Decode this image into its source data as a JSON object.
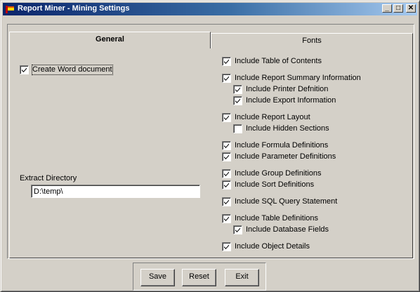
{
  "window": {
    "title": "Report Miner - Mining Settings",
    "controls": {
      "minimize": "_",
      "maximize": "□",
      "close": "✕"
    }
  },
  "tabs": [
    {
      "label": "General",
      "selected": true
    },
    {
      "label": "Fonts",
      "selected": false
    }
  ],
  "general": {
    "create_word": {
      "label": "Create Word document",
      "checked": true
    },
    "extract_directory": {
      "label": "Extract Directory",
      "value": "D:\\temp\\"
    }
  },
  "options": [
    {
      "label": "Include Table of Contents",
      "checked": true
    },
    {
      "label": "Include Report Summary Information",
      "checked": true
    },
    {
      "label": "Include Printer Defnition",
      "checked": true
    },
    {
      "label": "Include Export Information",
      "checked": true
    },
    {
      "label": "Include Report Layout",
      "checked": true
    },
    {
      "label": "Include Hidden Sections",
      "checked": false
    },
    {
      "label": "Include Formula Definitions",
      "checked": true
    },
    {
      "label": "Include Parameter Definitions",
      "checked": true
    },
    {
      "label": "Include Group Definitions",
      "checked": true
    },
    {
      "label": "Include Sort Definitions",
      "checked": true
    },
    {
      "label": "Include SQL Query Statement",
      "checked": true
    },
    {
      "label": "Include Table Definitions",
      "checked": true
    },
    {
      "label": "Include Database Fields",
      "checked": true
    },
    {
      "label": "Include Object Details",
      "checked": true
    }
  ],
  "buttons": {
    "save": "Save",
    "reset": "Reset",
    "exit": "Exit"
  }
}
